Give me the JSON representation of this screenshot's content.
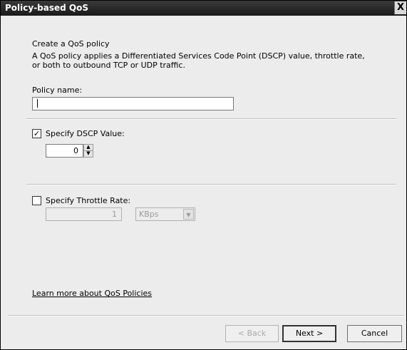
{
  "window": {
    "title": "Policy-based QoS",
    "close_glyph": "X"
  },
  "intro": {
    "heading": "Create a QoS policy",
    "line1": "A QoS policy applies a Differentiated Services Code Point (DSCP) value, throttle rate,",
    "line2": "or both to outbound TCP or UDP traffic."
  },
  "policy_name": {
    "label": "Policy name:",
    "value": ""
  },
  "dscp": {
    "checked": true,
    "check_glyph": "✓",
    "label": "Specify DSCP Value:",
    "value": "0"
  },
  "throttle": {
    "checked": false,
    "label": "Specify Throttle Rate:",
    "value": "1",
    "unit": "KBps"
  },
  "link": "Learn more about QoS Policies",
  "buttons": {
    "back": "< Back",
    "next": "Next >",
    "cancel": "Cancel"
  }
}
